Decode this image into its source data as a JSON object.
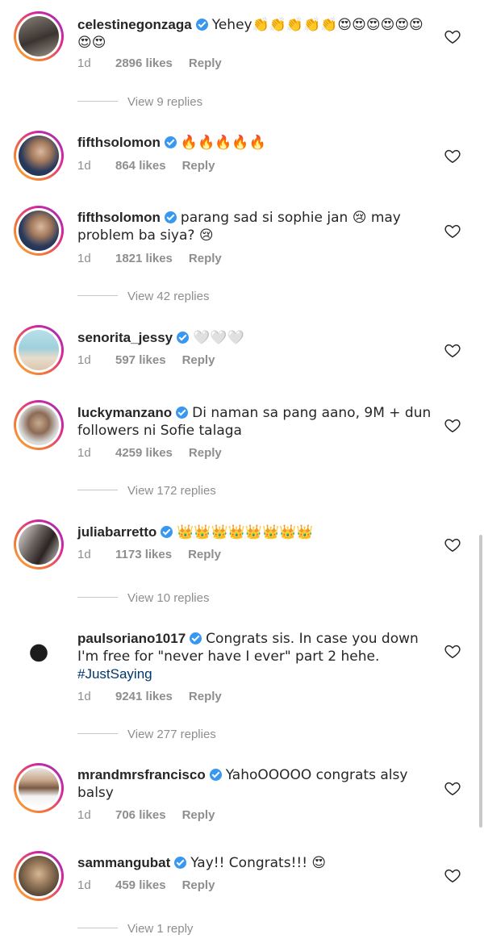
{
  "comments": [
    {
      "username": "celestinegonzaga",
      "text": "Yehey👏👏👏👏👏😍😍😍😍😍😍😍😍",
      "time": "1d",
      "likes": "2896 likes",
      "reply": "Reply",
      "view_replies": "View 9 replies"
    },
    {
      "username": "fifthsolomon",
      "text": "🔥🔥🔥🔥🔥",
      "time": "1d",
      "likes": "864 likes",
      "reply": "Reply"
    },
    {
      "username": "fifthsolomon",
      "text": "parang sad si sophie jan 😢 may problem ba siya? 😢",
      "time": "1d",
      "likes": "1821 likes",
      "reply": "Reply",
      "view_replies": "View 42 replies"
    },
    {
      "username": "senorita_jessy",
      "text": "🤍🤍🤍",
      "time": "1d",
      "likes": "597 likes",
      "reply": "Reply"
    },
    {
      "username": "luckymanzano",
      "text": "Di naman sa pang aano, 9M + dun followers ni Sofie talaga",
      "time": "1d",
      "likes": "4259 likes",
      "reply": "Reply",
      "view_replies": "View 172 replies"
    },
    {
      "username": "juliabarretto",
      "text": "👑👑👑👑👑👑👑👑",
      "time": "1d",
      "likes": "1173 likes",
      "reply": "Reply",
      "view_replies": "View 10 replies"
    },
    {
      "username": "paulsoriano1017",
      "text": "Congrats sis. In case you down I'm free for \"never have I ever\" part 2 hehe.",
      "hashtag": "#JustSaying",
      "time": "1d",
      "likes": "9241 likes",
      "reply": "Reply",
      "view_replies": "View 277 replies"
    },
    {
      "username": "mrandmrsfrancisco",
      "text": "YahoOOOOO congrats alsy balsy",
      "time": "1d",
      "likes": "706 likes",
      "reply": "Reply"
    },
    {
      "username": "sammangubat",
      "text": "Yay!! Congrats!!! 😍",
      "time": "1d",
      "likes": "459 likes",
      "reply": "Reply",
      "view_replies": "View 1 reply"
    }
  ],
  "icons": {
    "like": "heart-outline-icon",
    "verified": "verified-badge-icon"
  },
  "colors": {
    "verified": "#3897f0",
    "meta": "#8e8e8e",
    "hashtag": "#00376b"
  }
}
